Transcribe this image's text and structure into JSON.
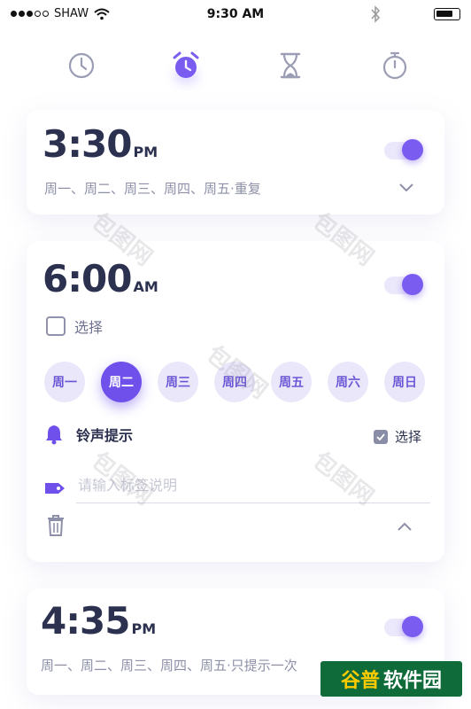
{
  "status": {
    "carrier": "SHAW",
    "time": "9:30 AM"
  },
  "tabs": [
    "clock-icon",
    "alarm-icon",
    "hourglass-icon",
    "stopwatch-icon"
  ],
  "accent": "#7a5cf0",
  "alarms": [
    {
      "time": "3:30",
      "ampm": "PM",
      "repeat": "周一、周二、周三、周四、周五·重复",
      "enabled": true
    },
    {
      "time": "6:00",
      "ampm": "AM",
      "enabled": true,
      "checkbox_label": "选择",
      "days": [
        "周一",
        "周二",
        "周三",
        "周四",
        "周五",
        "周六",
        "周日"
      ],
      "selected_day": "周二",
      "ringtone_label": "铃声提示",
      "ringtone_select_label": "选择",
      "tag_placeholder": "请输入标签说明"
    },
    {
      "time": "4:35",
      "ampm": "PM",
      "repeat": "周一、周二、周三、周四、周五·只提示一次",
      "enabled": true
    }
  ],
  "watermark": "包图网",
  "brand": {
    "part1": "谷普",
    "part2": "软件园"
  }
}
